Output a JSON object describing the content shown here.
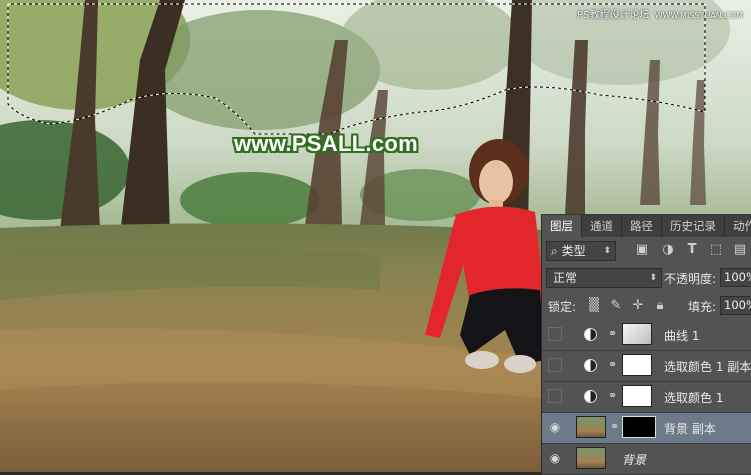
{
  "watermarks": {
    "top_right": "PS教程设计论坛",
    "top_right_url": "WWW.MISSYUAN.COM",
    "center_url": "www.PSALL.com"
  },
  "layers_panel": {
    "tabs": [
      "图层",
      "通道",
      "路径",
      "历史记录",
      "动作"
    ],
    "active_tab": "图层",
    "filter": {
      "label": "类型",
      "icon": "search-icon"
    },
    "filter_icons": [
      "image-icon",
      "adjustment-circle-icon",
      "text-icon",
      "shape-icon",
      "smart-object-icon"
    ],
    "blend_mode": "正常",
    "opacity_label": "不透明度:",
    "opacity_value": "100%",
    "lock_label": "锁定:",
    "lock_icons": [
      "lock-transparent-icon",
      "lock-brush-icon",
      "lock-move-icon",
      "lock-all-icon"
    ],
    "fill_label": "填充:",
    "fill_value": "100%",
    "layers": [
      {
        "name": "曲线 1",
        "type": "adjustment",
        "visible": false,
        "thumb": "curves",
        "selected": false
      },
      {
        "name": "选取颜色 1 副本",
        "type": "adjustment",
        "visible": false,
        "thumb": "white",
        "selected": false
      },
      {
        "name": "选取颜色 1",
        "type": "adjustment",
        "visible": false,
        "thumb": "white",
        "selected": false
      },
      {
        "name": "背景 副本",
        "type": "pixel-with-mask",
        "visible": true,
        "thumb": "photo",
        "selected": true
      },
      {
        "name": "背景",
        "type": "pixel",
        "visible": true,
        "thumb": "photo",
        "selected": false
      }
    ]
  },
  "colors": {
    "panel_bg": "#535353",
    "selected_layer": "#6c7a89",
    "watermark_outline": "#2f6f1d"
  }
}
